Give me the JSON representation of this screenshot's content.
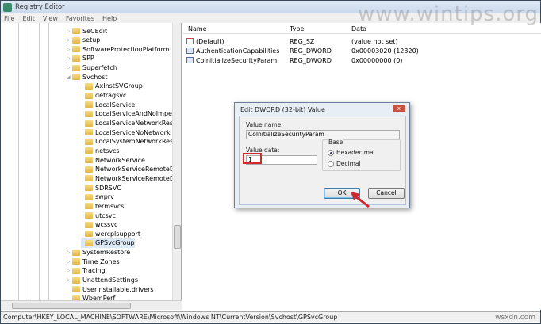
{
  "window": {
    "title": "Registry Editor"
  },
  "menu": [
    "File",
    "Edit",
    "View",
    "Favorites",
    "Help"
  ],
  "tree": [
    {
      "label": "SeCEdit",
      "level": 0,
      "exp": "▷"
    },
    {
      "label": "setup",
      "level": 0,
      "exp": "▷"
    },
    {
      "label": "SoftwareProtectionPlatform",
      "level": 0,
      "exp": "▷"
    },
    {
      "label": "SPP",
      "level": 0,
      "exp": "▷"
    },
    {
      "label": "Superfetch",
      "level": 0,
      "exp": "▷"
    },
    {
      "label": "Svchost",
      "level": 0,
      "exp": "◢"
    },
    {
      "label": "AxInstSVGroup",
      "level": 1
    },
    {
      "label": "defragsvc",
      "level": 1
    },
    {
      "label": "LocalService",
      "level": 1
    },
    {
      "label": "LocalServiceAndNoImperson",
      "level": 1
    },
    {
      "label": "LocalServiceNetworkRestricte",
      "level": 1
    },
    {
      "label": "LocalServiceNoNetwork",
      "level": 1
    },
    {
      "label": "LocalSystemNetworkRestricte",
      "level": 1
    },
    {
      "label": "netsvcs",
      "level": 1
    },
    {
      "label": "NetworkService",
      "level": 1
    },
    {
      "label": "NetworkServiceRemoteDeskt",
      "level": 1
    },
    {
      "label": "NetworkServiceRemoteDeskt",
      "level": 1
    },
    {
      "label": "SDRSVC",
      "level": 1
    },
    {
      "label": "swprv",
      "level": 1
    },
    {
      "label": "termsvcs",
      "level": 1
    },
    {
      "label": "utcsvc",
      "level": 1
    },
    {
      "label": "wcssvc",
      "level": 1
    },
    {
      "label": "wercplsupport",
      "level": 1
    },
    {
      "label": "GPSvcGroup",
      "level": 1,
      "selected": true
    },
    {
      "label": "SystemRestore",
      "level": 0,
      "exp": "▷"
    },
    {
      "label": "Time Zones",
      "level": 0,
      "exp": "▷"
    },
    {
      "label": "Tracing",
      "level": 0,
      "exp": "▷"
    },
    {
      "label": "UnattendSettings",
      "level": 0,
      "exp": "▷"
    },
    {
      "label": "Userinstallable.drivers",
      "level": 0
    },
    {
      "label": "WbemPerf",
      "level": 0
    }
  ],
  "list": {
    "headers": {
      "name": "Name",
      "type": "Type",
      "data": "Data"
    },
    "rows": [
      {
        "icon": "string-value-icon",
        "name": "(Default)",
        "type": "REG_SZ",
        "data": "(value not set)"
      },
      {
        "icon": "dword-value-icon",
        "name": "AuthenticationCapabilities",
        "type": "REG_DWORD",
        "data": "0x00003020 (12320)"
      },
      {
        "icon": "dword-value-icon",
        "name": "CoInitializeSecurityParam",
        "type": "REG_DWORD",
        "data": "0x00000000 (0)"
      }
    ]
  },
  "dialog": {
    "title": "Edit DWORD (32-bit) Value",
    "close": "x",
    "value_name_label": "Value name:",
    "value_name": "CoInitializeSecurityParam",
    "value_data_label": "Value data:",
    "value_data": "1",
    "base_label": "Base",
    "hex_label": "Hexadecimal",
    "dec_label": "Decimal",
    "ok": "OK",
    "cancel": "Cancel"
  },
  "status": "Computer\\HKEY_LOCAL_MACHINE\\SOFTWARE\\Microsoft\\Windows NT\\CurrentVersion\\Svchost\\GPSvcGroup",
  "watermarks": {
    "top": "www.wintips.org",
    "bottom": "wsxdn.com"
  },
  "colors": {
    "highlight": "#d3262e"
  }
}
